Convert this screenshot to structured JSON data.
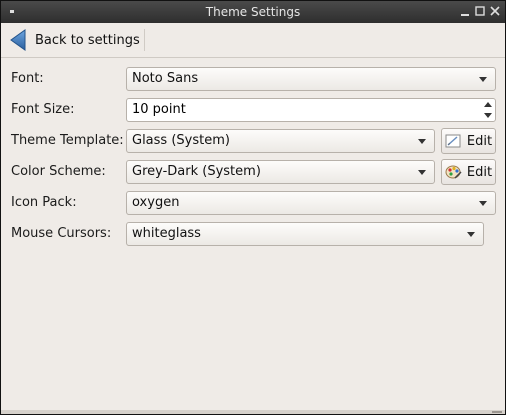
{
  "window": {
    "title": "Theme Settings"
  },
  "toolbar": {
    "back_label": "Back to settings"
  },
  "fields": {
    "font": {
      "label": "Font:",
      "value": "Noto Sans"
    },
    "font_size": {
      "label": "Font Size:",
      "value": "10 point"
    },
    "theme_template": {
      "label": "Theme Template:",
      "value": "Glass (System)",
      "edit_label": "Edit"
    },
    "color_scheme": {
      "label": "Color Scheme:",
      "value": "Grey-Dark (System)",
      "edit_label": "Edit"
    },
    "icon_pack": {
      "label": "Icon Pack:",
      "value": "oxygen"
    },
    "mouse_cursors": {
      "label": "Mouse Cursors:",
      "value": "whiteglass"
    }
  },
  "icons": {
    "back": "arrow-left-icon",
    "edit_template": "document-edit-icon",
    "edit_color": "color-palette-icon"
  },
  "colors": {
    "accent": "#2f6fb4",
    "window_bg": "#efebe7",
    "titlebar_bg": "#3a3a3a"
  }
}
